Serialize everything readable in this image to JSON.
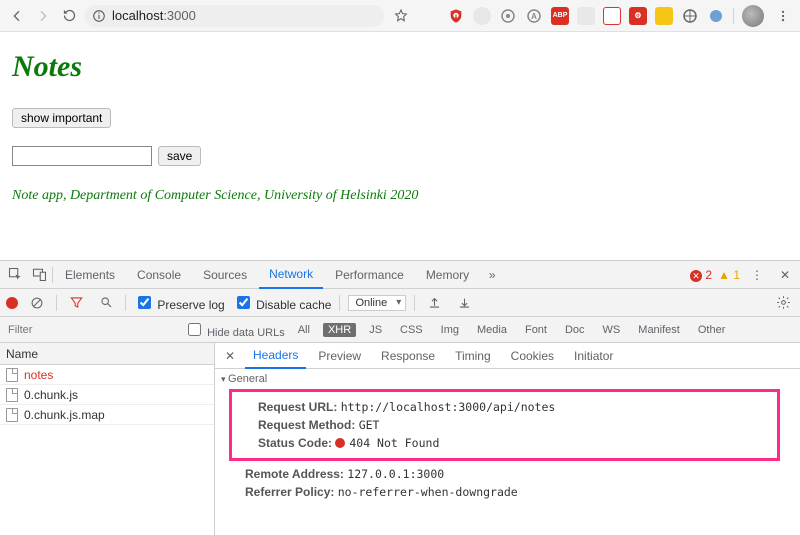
{
  "browser": {
    "url_prefix": "localhost",
    "url_suffix": ":3000"
  },
  "page": {
    "title": "Notes",
    "show_button": "show important",
    "save_button": "save",
    "footer": "Note app, Department of Computer Science, University of Helsinki 2020"
  },
  "devtools": {
    "tabs": [
      "Elements",
      "Console",
      "Sources",
      "Network",
      "Performance",
      "Memory"
    ],
    "active_tab": "Network",
    "errors": "2",
    "warnings": "1",
    "preserve_log": "Preserve log",
    "disable_cache": "Disable cache",
    "throttle": "Online",
    "filter_placeholder": "Filter",
    "hide_data_urls": "Hide data URLs",
    "filter_types": [
      "All",
      "XHR",
      "JS",
      "CSS",
      "Img",
      "Media",
      "Font",
      "Doc",
      "WS",
      "Manifest",
      "Other"
    ],
    "selected_filter": "XHR",
    "name_header": "Name",
    "requests": [
      {
        "name": "notes",
        "error": true
      },
      {
        "name": "0.chunk.js",
        "error": false
      },
      {
        "name": "0.chunk.js.map",
        "error": false
      }
    ],
    "detail_tabs": [
      "Headers",
      "Preview",
      "Response",
      "Timing",
      "Cookies",
      "Initiator"
    ],
    "detail_active": "Headers",
    "general_title": "General",
    "general": {
      "request_url_label": "Request URL:",
      "request_url": "http://localhost:3000/api/notes",
      "request_method_label": "Request Method:",
      "request_method": "GET",
      "status_code_label": "Status Code:",
      "status_code": "404 Not Found",
      "remote_address_label": "Remote Address:",
      "remote_address": "127.0.0.1:3000",
      "referrer_policy_label": "Referrer Policy:",
      "referrer_policy": "no-referrer-when-downgrade"
    }
  }
}
